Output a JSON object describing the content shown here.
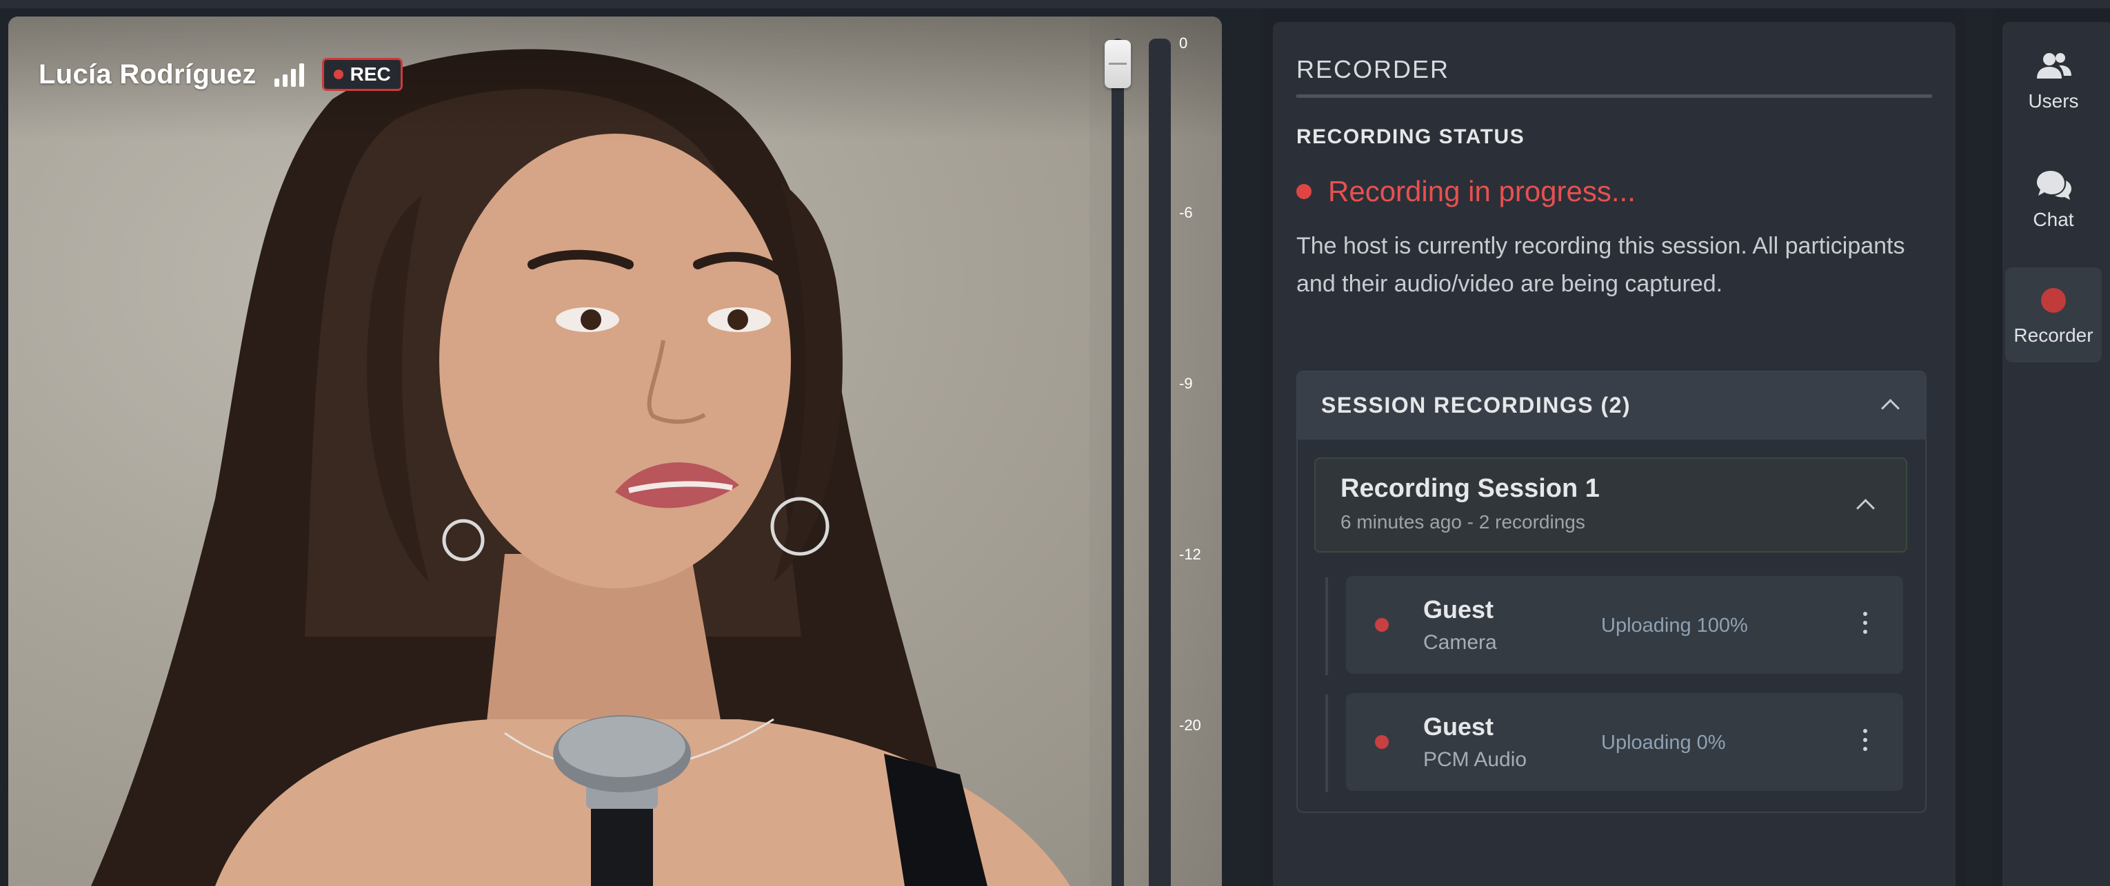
{
  "video": {
    "participant_name": "Lucía Rodríguez",
    "rec_badge": "REC",
    "signal_icon": "signal-bars-icon",
    "audio_meter_ticks": [
      "0",
      "-6",
      "-9",
      "-12",
      "-20"
    ]
  },
  "recorder": {
    "title": "RECORDER",
    "status_heading": "RECORDING STATUS",
    "status_text": "Recording in progress...",
    "status_description": "The host is currently recording this session. All participants and their audio/video are being captured.",
    "sessions_title": "SESSION RECORDINGS (2)",
    "sessions": [
      {
        "name": "Recording Session 1",
        "meta": "6 minutes ago - 2 recordings",
        "recordings": [
          {
            "source": "Guest",
            "type": "Camera",
            "status": "Uploading 100%"
          },
          {
            "source": "Guest",
            "type": "PCM Audio",
            "status": "Uploading 0%"
          }
        ]
      }
    ]
  },
  "sidebar": {
    "items": [
      {
        "label": "Users",
        "icon": "users-icon"
      },
      {
        "label": "Chat",
        "icon": "chat-icon"
      },
      {
        "label": "Recorder",
        "icon": "record-dot-icon",
        "active": true
      }
    ]
  },
  "colors": {
    "accent_red": "#e04545",
    "panel_bg": "#2b3038",
    "status_blue": "#8ea2b3"
  }
}
